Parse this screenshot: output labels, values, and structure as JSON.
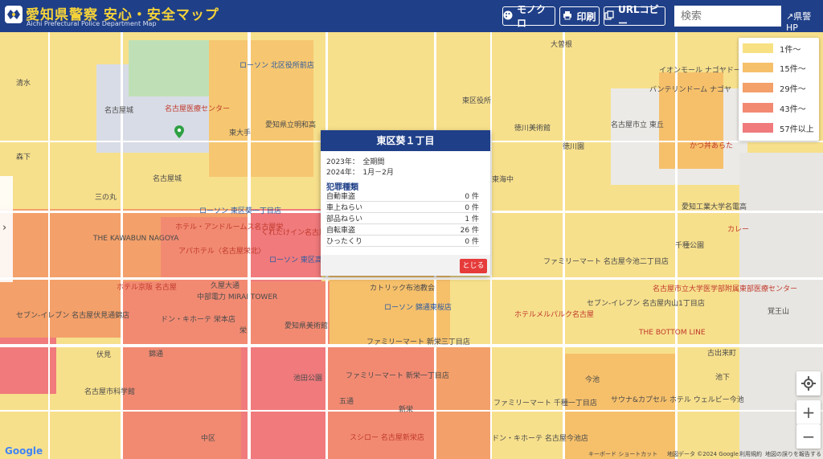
{
  "header": {
    "title": "愛知県警察 安心・安全マップ",
    "subtitle": "Aichi Prefectural Police Department Map",
    "buttons": {
      "mono": "モノクロ",
      "print": "印刷",
      "url_copy": "URLコピー"
    },
    "search_placeholder": "検索",
    "pref_hp": "県警HP"
  },
  "legend": [
    {
      "label": "1件～",
      "color": "#f8e183"
    },
    {
      "label": "15件～",
      "color": "#f6c06b"
    },
    {
      "label": "29件～",
      "color": "#f3a06a"
    },
    {
      "label": "43件～",
      "color": "#f28a72"
    },
    {
      "label": "57件以上",
      "color": "#f07a7c"
    }
  ],
  "popup": {
    "title": "東区葵１丁目",
    "line_2023": "2023年：　全期間",
    "line_2024": "2024年：　1月－2月",
    "category_heading": "犯罪種類",
    "rows": [
      {
        "label": "自動車盗",
        "value": "0 件"
      },
      {
        "label": "車上ねらい",
        "value": "0 件"
      },
      {
        "label": "部品ねらい",
        "value": "1 件"
      },
      {
        "label": "自転車盗",
        "value": "26 件"
      },
      {
        "label": "ひったくり",
        "value": "0 件"
      }
    ],
    "close": "とじる"
  },
  "map_labels": [
    "名古屋城",
    "名古屋医療センター",
    "ローソン 北区役所前店",
    "東大手",
    "愛知県立明和高",
    "名古屋城",
    "三の丸",
    "ホテル・アンドルームス名古屋栄",
    "くれたけイン名古屋久屋大通",
    "アパホテル〈名古屋栄北〉",
    "ホテル京阪 名古屋",
    "中部電力 MIRAI TOWER",
    "ドン・キホーテ 栄本店",
    "愛知県美術館",
    "久屋大通",
    "栄",
    "伏見",
    "錦通",
    "名古屋市科学館",
    "中区",
    "池田公園",
    "五通",
    "新栄",
    "ファミリーマート 新栄一丁目店",
    "スシロー 名古屋新栄店",
    "カトリック布池教会",
    "ローソン 錦通東桜店",
    "徳川美術館",
    "名古屋市立 東丘",
    "東海中",
    "千種公園",
    "ホテルメルパルク名古屋",
    "サウナ&カプセル ホテル ウェルビー今池",
    "ファミリーマート 千種一丁目店",
    "ドン・キホーテ 名古屋今池店",
    "今池",
    "THE BOTTOM LINE",
    "古出来町",
    "愛知工業大学名電高",
    "名古屋市立大学医学部附属東部医療センター",
    "覚王山",
    "池下",
    "セブン-イレブン 名古屋内山1丁目店",
    "ファミリーマート 名古屋今池二丁目店",
    "ローソン 東区葵一丁目店",
    "ローソン 東区高岳店",
    "THE KAWABUN NAGOYA",
    "セブン-イレブン 名古屋伏見通錦店",
    "ファミリーマート 新栄三丁目店",
    "東区役所",
    "徳川園",
    "森下",
    "清水",
    "大曽根",
    "イオンモール ナゴヤドーム前",
    "バンテリンドーム ナゴヤ",
    "かつ丼あらた",
    "カレー"
  ],
  "footer": {
    "google": "Google",
    "shortcuts": "キーボード ショートカット",
    "map_data": "地図データ ©2024 Google",
    "terms": "利用規約",
    "report": "地図の誤りを報告する"
  }
}
